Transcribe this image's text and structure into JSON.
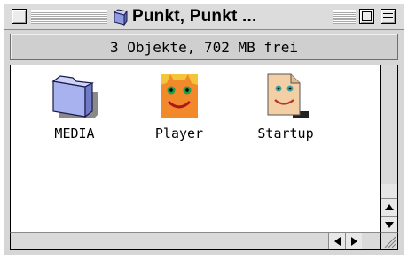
{
  "window": {
    "title": "Punkt, Punkt ..."
  },
  "header": {
    "status": "3 Objekte, 702 MB frei"
  },
  "items": [
    {
      "label": "MEDIA",
      "icon": "folder-icon"
    },
    {
      "label": "Player",
      "icon": "face-app-icon"
    },
    {
      "label": "Startup",
      "icon": "face-document-icon"
    }
  ],
  "colors": {
    "folder": "#9aa6e6",
    "face": "#f08a2a",
    "document": "#f2cfa8"
  }
}
